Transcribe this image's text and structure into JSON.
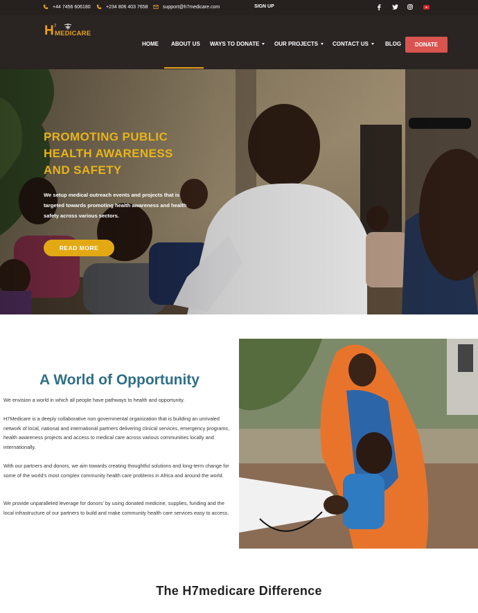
{
  "topbar": {
    "phone1": "+44 7456 606180",
    "phone2": "+234 806 403 7658",
    "email": "support@h7medicare.com",
    "signup": "SIGN UP",
    "social_icons": [
      "facebook-icon",
      "twitter-icon",
      "instagram-icon",
      "youtube-icon"
    ]
  },
  "header": {
    "logo_h": "H",
    "logo_seven": "7",
    "logo_text": "MEDICARE",
    "nav": [
      {
        "label": "HOME",
        "dropdown": false
      },
      {
        "label": "ABOUT US",
        "dropdown": false,
        "active": true
      },
      {
        "label": "WAYS TO DONATE",
        "dropdown": true
      },
      {
        "label": "OUR PROJECTS",
        "dropdown": true
      },
      {
        "label": "CONTACT US",
        "dropdown": true
      },
      {
        "label": "BLOG",
        "dropdown": false
      }
    ],
    "donate_label": "DONATE"
  },
  "hero": {
    "title": "PROMOTING PUBLIC HEALTH AWARENESS AND SAFETY",
    "text": "We setup medical outreach events and projects that is targeted towards promoting health awareness and health safety across various sectors.",
    "button": "READ MORE"
  },
  "about": {
    "title": "A World of Opportunity",
    "paragraphs": [
      "We envision a world in which all people have pathways to health and opportunity.",
      "H7Medicare is a deeply collaborative non governmental  organization that is building an unrivaled network of local, national and international partners delivering clinical services, emergency programs, health awareness projects and access to medical care across various communities locally and internationally.",
      "With our partners and donors, we aim towards creating thoughtful solutions and long-term change for some of the world's most complex community health care problems in Africa and around the world.",
      "We provide unparalleled leverage for donors' by using donated medicine, supplies, funding and the local infrastructure of our partners to build and make community health care services easy to access."
    ]
  },
  "difference": {
    "title": "The H7medicare Difference"
  },
  "colors": {
    "accent": "#e8a21b",
    "donate": "#d9534f",
    "heading_blue": "#2f6f86",
    "dark": "#26201f"
  }
}
